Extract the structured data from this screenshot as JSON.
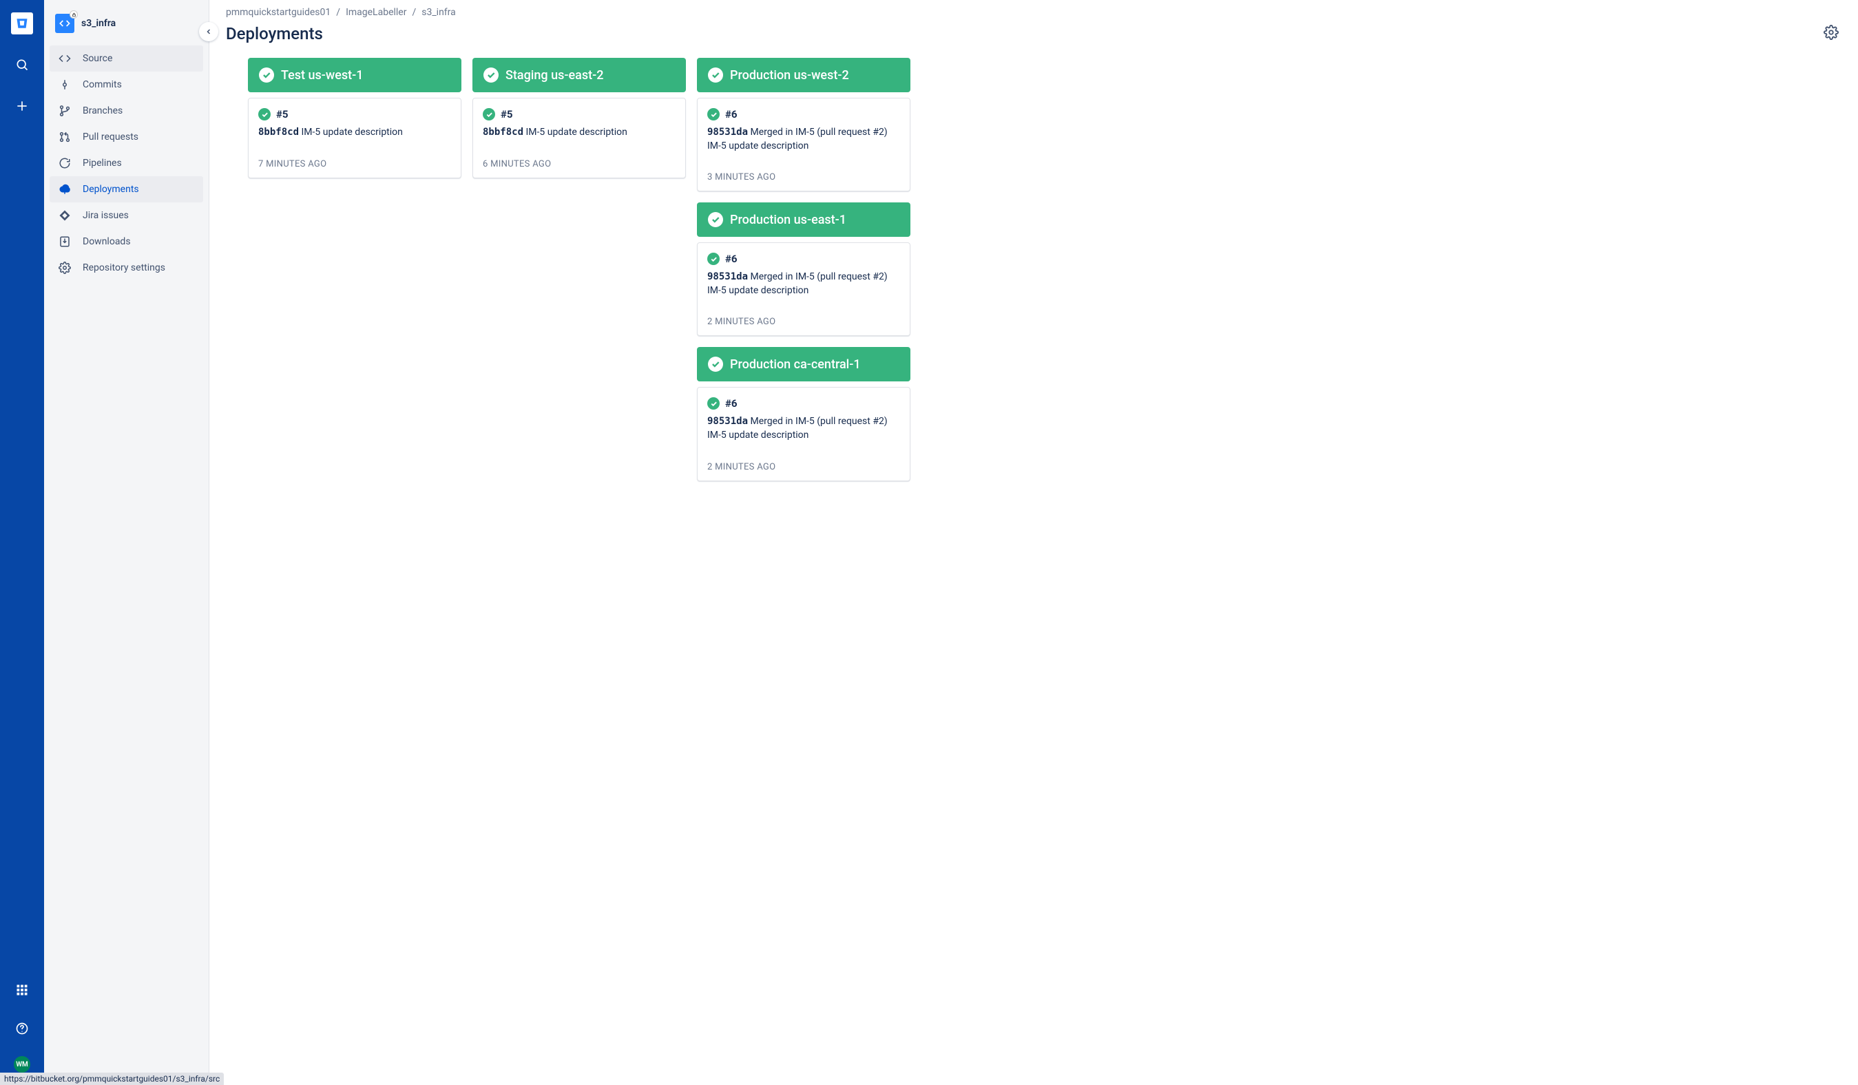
{
  "globalNav": {
    "appSwitcher": "app-switcher",
    "help": "help",
    "avatarInitials": "WM"
  },
  "repo": {
    "name": "s3_infra"
  },
  "sidebar": {
    "items": [
      {
        "label": "Source",
        "icon": "code-icon",
        "highlight": true
      },
      {
        "label": "Commits",
        "icon": "commit-icon"
      },
      {
        "label": "Branches",
        "icon": "branch-icon"
      },
      {
        "label": "Pull requests",
        "icon": "pullrequest-icon"
      },
      {
        "label": "Pipelines",
        "icon": "pipelines-icon"
      },
      {
        "label": "Deployments",
        "icon": "deploy-icon",
        "selected": true
      },
      {
        "label": "Jira issues",
        "icon": "jira-icon"
      },
      {
        "label": "Downloads",
        "icon": "download-icon"
      },
      {
        "label": "Repository settings",
        "icon": "settings-icon"
      }
    ]
  },
  "breadcrumb": {
    "items": [
      "pmmquickstartguides01",
      "ImageLabeller",
      "s3_infra"
    ]
  },
  "page": {
    "title": "Deployments"
  },
  "columns": [
    {
      "envs": [
        {
          "name": "Test us-west-1",
          "build": "#5",
          "hash": "8bbf8cd",
          "message": "IM-5 update description",
          "time": "7 MINUTES AGO"
        }
      ]
    },
    {
      "envs": [
        {
          "name": "Staging us-east-2",
          "build": "#5",
          "hash": "8bbf8cd",
          "message": "IM-5 update description",
          "time": "6 MINUTES AGO"
        }
      ]
    },
    {
      "envs": [
        {
          "name": "Production us-west-2",
          "build": "#6",
          "hash": "98531da",
          "message": "Merged in IM-5 (pull request #2) IM-5 update description",
          "time": "3 MINUTES AGO"
        },
        {
          "name": "Production us-east-1",
          "build": "#6",
          "hash": "98531da",
          "message": "Merged in IM-5 (pull request #2) IM-5 update description",
          "time": "2 MINUTES AGO"
        },
        {
          "name": "Production ca-central-1",
          "build": "#6",
          "hash": "98531da",
          "message": "Merged in IM-5 (pull request #2) IM-5 update description",
          "time": "2 MINUTES AGO"
        }
      ]
    }
  ],
  "statusBar": "https://bitbucket.org/pmmquickstartguides01/s3_infra/src"
}
